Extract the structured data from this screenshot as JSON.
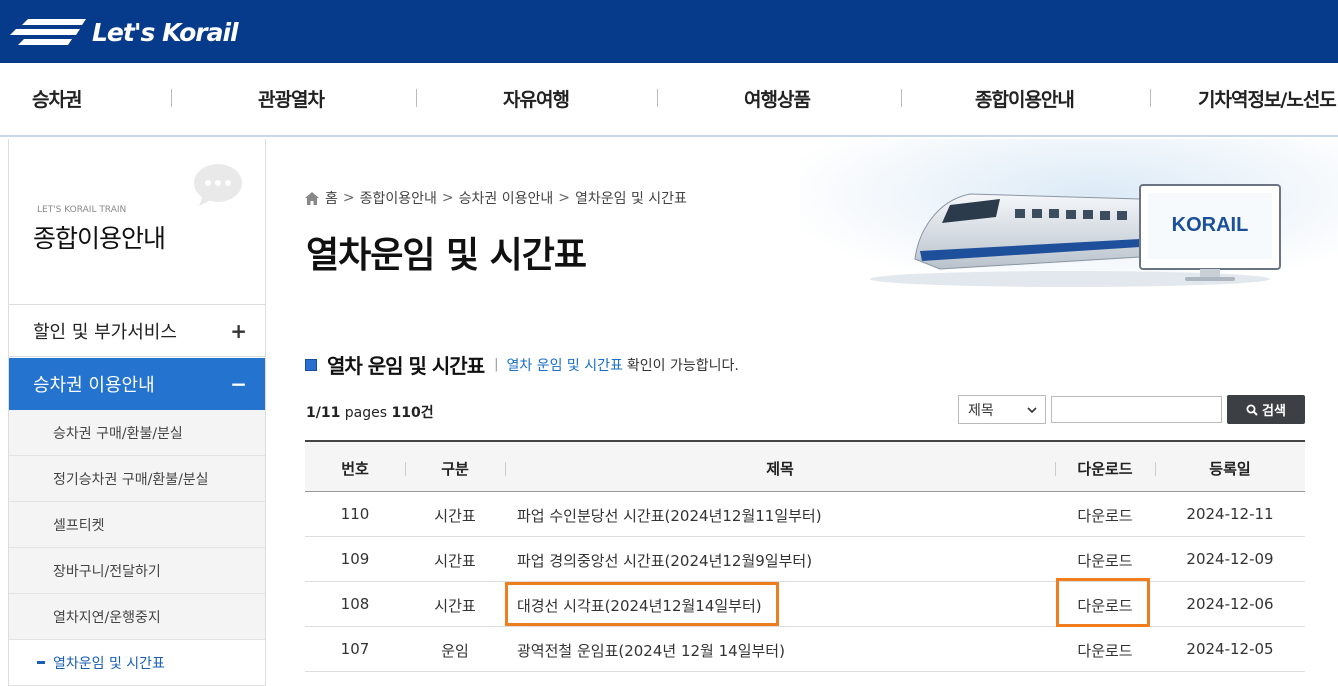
{
  "header": {
    "logo_text": "Let's Korail",
    "brand_color": "#063a8b"
  },
  "nav": {
    "items": [
      "승차권",
      "관광열차",
      "자유여행",
      "여행상품",
      "종합이용안내",
      "기차역정보/노선도"
    ]
  },
  "sidebar": {
    "subtitle": "LET'S KORAIL TRAIN",
    "title": "종합이용안내",
    "menus": [
      {
        "label": "할인 및 부가서비스",
        "toggle": "+"
      },
      {
        "label": "승차권 이용안내",
        "toggle": "−"
      }
    ],
    "sub_items": [
      "승차권 구매/환불/분실",
      "정기승차권 구매/환불/분실",
      "셀프티켓",
      "장바구니/전달하기",
      "열차지연/운행중지",
      "열차운임 및 시간표"
    ],
    "active_color": "#2473cf"
  },
  "breadcrumb": {
    "home": "홈",
    "items": [
      "종합이용안내",
      "승차권 이용안내",
      "열차운임 및 시간표"
    ],
    "separator": ">"
  },
  "page": {
    "title": "열차운임 및 시간표",
    "banner_logo": "KORAIL"
  },
  "section": {
    "title": "열차 운임 및 시간표",
    "bar": "|",
    "link": "열차 운임 및 시간표",
    "rest": "확인이 가능합니다."
  },
  "pager": {
    "page": "1/11",
    "pages_label": "pages",
    "count": "110건"
  },
  "search": {
    "select_value": "제목",
    "input_value": "",
    "button_label": "검색"
  },
  "table": {
    "headers": [
      "번호",
      "구분",
      "제목",
      "다운로드",
      "등록일"
    ],
    "rows": [
      {
        "no": "110",
        "type": "시간표",
        "title": "파업 수인분당선 시간표(2024년12월11일부터)",
        "download": "다운로드",
        "date": "2024-12-11"
      },
      {
        "no": "109",
        "type": "시간표",
        "title": "파업 경의중앙선 시간표(2024년12월9일부터)",
        "download": "다운로드",
        "date": "2024-12-09"
      },
      {
        "no": "108",
        "type": "시간표",
        "title": "대경선 시각표(2024년12월14일부터)",
        "download": "다운로드",
        "date": "2024-12-06"
      },
      {
        "no": "107",
        "type": "운임",
        "title": "광역전철 운임표(2024년 12월 14일부터)",
        "download": "다운로드",
        "date": "2024-12-05"
      }
    ]
  },
  "highlight_color": "#f07d1e"
}
